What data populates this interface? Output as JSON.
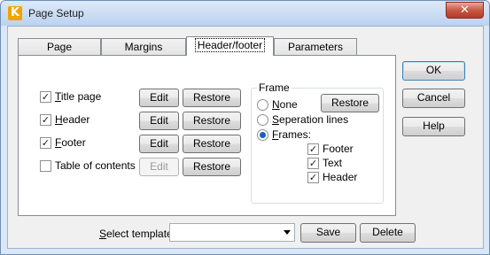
{
  "window": {
    "title": "Page Setup",
    "close_glyph": "✕",
    "app_icon_letter": "K"
  },
  "tabs": [
    {
      "label": "Page"
    },
    {
      "label": "Margins"
    },
    {
      "label": "Header/footer"
    },
    {
      "label": "Parameters"
    }
  ],
  "options": [
    {
      "label": "Title page",
      "checked": "✓",
      "edit": "Edit",
      "restore": "Restore"
    },
    {
      "label": "Header",
      "checked": "✓",
      "edit": "Edit",
      "restore": "Restore"
    },
    {
      "label": "Footer",
      "checked": "✓",
      "edit": "Edit",
      "restore": "Restore"
    },
    {
      "label": "Table of contents",
      "checked": "",
      "edit": "Edit",
      "restore": "Restore"
    }
  ],
  "frame": {
    "legend": "Frame",
    "restore": "Restore",
    "radios": [
      {
        "label": "None"
      },
      {
        "label": "Seperation lines"
      },
      {
        "label": "Frames:"
      }
    ],
    "frame_checks": [
      {
        "label": "Footer",
        "checked": "✓"
      },
      {
        "label": "Text",
        "checked": "✓"
      },
      {
        "label": "Header",
        "checked": "✓"
      }
    ]
  },
  "side_buttons": {
    "ok": "OK",
    "cancel": "Cancel",
    "help": "Help"
  },
  "template": {
    "label": "Select template:",
    "value": "",
    "save": "Save",
    "delete": "Delete"
  }
}
